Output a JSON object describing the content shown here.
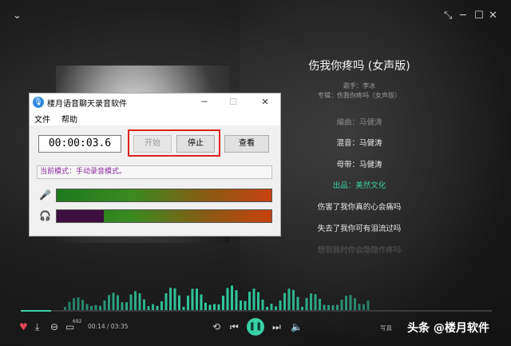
{
  "player": {
    "song_title": "伤我你疼吗 (女声版)",
    "singer_line": "歌手：李冰",
    "album_line": "专辑：伤我你疼吗（女声版）",
    "lyrics": [
      {
        "text": "编曲：马健涛",
        "state": "faded"
      },
      {
        "text": "混音：马健涛",
        "state": "normal"
      },
      {
        "text": "母带：马健涛",
        "state": "normal"
      },
      {
        "text": "出品：美然文化",
        "state": "active"
      },
      {
        "text": "伤害了我你真的心会痛吗",
        "state": "normal"
      },
      {
        "text": "失去了我你可有泪流过吗",
        "state": "normal"
      },
      {
        "text": "想到我时你会隐隐作疼吗",
        "state": "faded"
      }
    ],
    "time": "00:14 / 03:35",
    "progress": 0.065,
    "comment_count": "692",
    "lyric_mode": "写真",
    "accent": "#39d1a6"
  },
  "icons": {
    "collapse": "chevron-down-icon",
    "shrink": "shrink-icon",
    "minimize": "minimize-icon",
    "maximize": "maximize-icon",
    "close": "close-icon"
  },
  "watermark": "头条 @楼月软件",
  "recorder": {
    "title": "楼月语音聊天录音软件",
    "menu": [
      "文件",
      "帮助"
    ],
    "timer": "00:00:03.6",
    "buttons": {
      "start": "开始",
      "stop": "停止",
      "view": "查看"
    },
    "mode": "当前模式：手动录音模式。",
    "mic_level": 1.0,
    "speaker_level": 0.22,
    "highlight_color": "#e02020"
  }
}
